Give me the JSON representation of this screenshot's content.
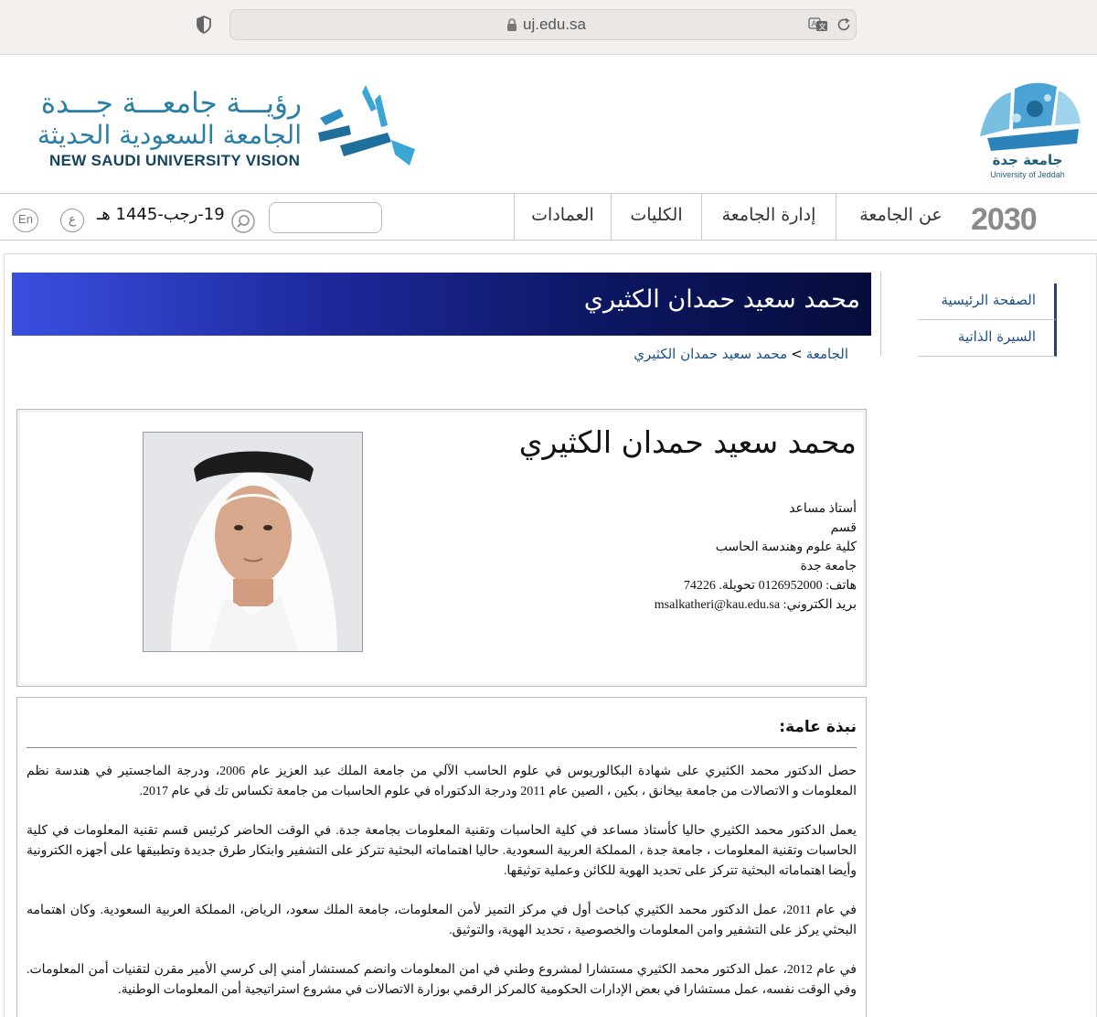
{
  "browser": {
    "url": "uj.edu.sa"
  },
  "header": {
    "vision_line1": "رؤيـــة جامعـــة جـــدة",
    "vision_line2": "الجامعة السعودية الحديثة",
    "vision_en": "NEW SAUDI UNIVERSITY VISION",
    "uj_name_ar": "جامعة جدة",
    "uj_name_en": "University of Jeddah"
  },
  "nav": {
    "vision_2030": "2030",
    "items": [
      "عن الجامعة",
      "إدارة الجامعة",
      "الكليات",
      "العمادات"
    ],
    "date": "19-رجب-1445 هـ",
    "ar_label": "ع",
    "en_label": "En"
  },
  "sidebar": {
    "items": [
      "الصفحة الرئيسية",
      "السيرة الذاتية"
    ]
  },
  "page": {
    "title": "محمد سعيد حمدان الكثيري",
    "breadcrumb_root": "الجامعة",
    "breadcrumb_sep": ">",
    "breadcrumb_current": "محمد سعيد حمدان الكثيري"
  },
  "profile": {
    "name": "محمد سعيد حمدان الكثيري",
    "rank": "أستاذ مساعد",
    "department": "قسم",
    "college": "كلية علوم وهندسة الحاسب",
    "university": "جامعة جدة",
    "phone": "هاتف: 0126952000 تحويلة. 74226",
    "email": "بريد الكتروني: msalkatheri@kau.edu.sa"
  },
  "bio": {
    "title": "نبذة عامة:",
    "paragraphs": [
      "حصل الدكتور محمد الكثيري على شهادة البكالوريوس في علوم الحاسب الآلي من جامعة الملك عبد العزيز عام 2006، ودرجة الماجستير في هندسة نظم المعلومات و الاتصالات من جامعة بيخانق ، بكين ، الصين عام 2011 ودرجة الدكتوراه في علوم الحاسبات من جامعة تكساس تك في عام 2017.",
      "يعمل الدكتور محمد الكثيري حاليا كأستاذ مساعد في كلية الحاسبات وتقنية المعلومات بجامعة جدة. في الوقت الحاضر كرئيس قسم تقنية المعلومات في كلية الحاسبات وتقنية المعلومات ، جامعة جدة ، المملكة العربية السعودية. حاليا اهتماماته البحثية تتركز على التشفير وابتكار طرق جديدة وتطبيقها على أجهزه الكترونية وأيضا اهتماماته البحثية تتركز على تحديد الهوية للكائن وعملية توثيقها.",
      "في عام 2011، عمل الدكتور محمد الكثيري كباحث أول في مركز التميز لأمن المعلومات، جامعة الملك سعود، الرياض، المملكة العربية السعودية. وكان اهتمامه البحثي يركز على التشفير وامن المعلومات والخصوصية ، تحديد الهوية، والتوثيق.",
      "في عام 2012، عمل الدكتور محمد الكثيري مستشارا لمشروع وطني في امن المعلومات وانضم كمستشار أمني إلى كرسي الأمير مقرن لتقنيات أمن المعلومات. وفي الوقت نفسه، عمل مستشارا في بعض الإدارات الحكومية كالمركز الرقمي بوزارة الاتصالات في مشروع استراتيجية أمن المعلومات الوطنية."
    ]
  },
  "colors": {
    "band_start": "#3a4fe0",
    "band_end": "#060d3c",
    "link": "#1b4f8a",
    "brand_teal": "#2a7fa5"
  }
}
